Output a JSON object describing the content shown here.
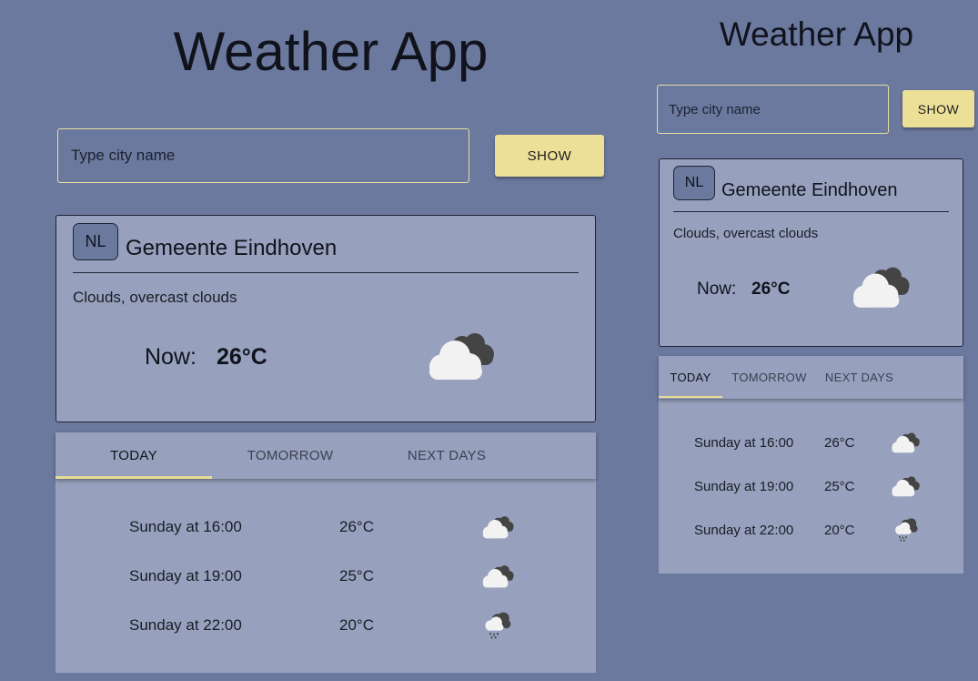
{
  "app_title": "Weather App",
  "search": {
    "placeholder": "Type city name",
    "value": ""
  },
  "show_button_label": "SHOW",
  "current": {
    "country_code": "NL",
    "city": "Gemeente Eindhoven",
    "description": "Clouds, overcast clouds",
    "now_label": "Now:",
    "temperature": "26°C",
    "icon": "overcast-clouds-icon"
  },
  "tabs": [
    "TODAY",
    "TOMORROW",
    "NEXT DAYS"
  ],
  "active_tab": "TODAY",
  "forecast": [
    {
      "time": "Sunday at 16:00",
      "temp": "26°C",
      "icon": "overcast-clouds-icon"
    },
    {
      "time": "Sunday at 19:00",
      "temp": "25°C",
      "icon": "overcast-clouds-icon"
    },
    {
      "time": "Sunday at 22:00",
      "temp": "20°C",
      "icon": "light-rain-icon"
    }
  ],
  "colors": {
    "background": "#6b799e",
    "card": "#97a1bd",
    "accent_button": "#ece099",
    "tab_underline": "#e7dc93",
    "input_border": "#e7dfa1"
  }
}
